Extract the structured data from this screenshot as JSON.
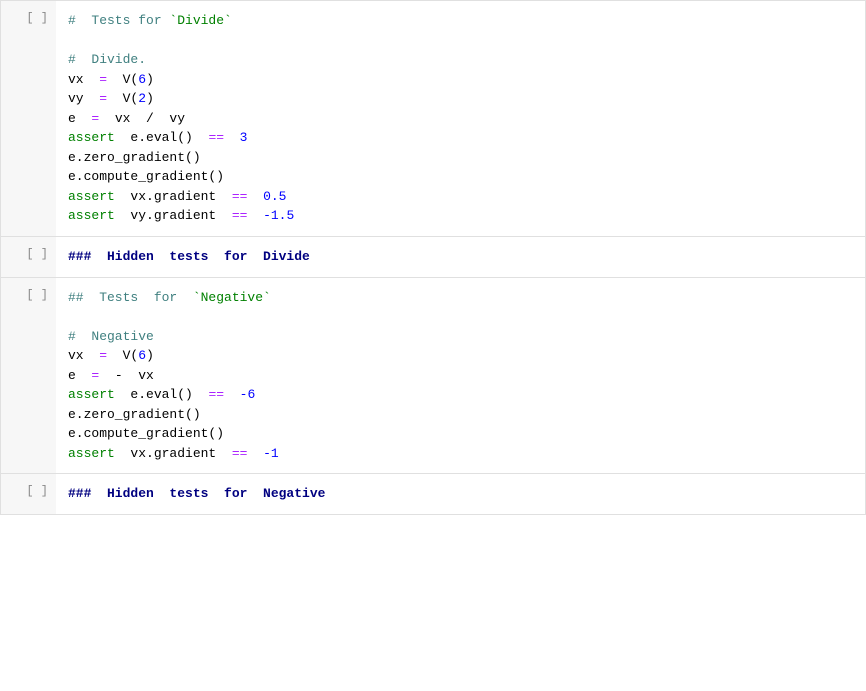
{
  "cells": [
    {
      "id": "cell-1",
      "gutter": "[ ]",
      "lines": [
        {
          "id": "l1",
          "parts": [
            {
              "type": "comment",
              "text": "#  Tests for "
            },
            {
              "type": "backtick",
              "text": "`Divide`"
            }
          ]
        },
        {
          "id": "l2",
          "parts": []
        },
        {
          "id": "l3",
          "parts": [
            {
              "type": "comment",
              "text": "#  Divide."
            }
          ]
        },
        {
          "id": "l4",
          "parts": [
            {
              "type": "plain",
              "text": "vx  "
            },
            {
              "type": "op",
              "text": "="
            },
            {
              "type": "plain",
              "text": "  V("
            },
            {
              "type": "num",
              "text": "6"
            },
            {
              "type": "plain",
              "text": ")"
            }
          ]
        },
        {
          "id": "l5",
          "parts": [
            {
              "type": "plain",
              "text": "vy  "
            },
            {
              "type": "op",
              "text": "="
            },
            {
              "type": "plain",
              "text": "  V("
            },
            {
              "type": "num",
              "text": "2"
            },
            {
              "type": "plain",
              "text": ")"
            }
          ]
        },
        {
          "id": "l6",
          "parts": [
            {
              "type": "plain",
              "text": "e  "
            },
            {
              "type": "op",
              "text": "="
            },
            {
              "type": "plain",
              "text": "  vx  /  vy"
            }
          ]
        },
        {
          "id": "l7",
          "parts": [
            {
              "type": "assert",
              "text": "assert"
            },
            {
              "type": "plain",
              "text": "  e.eval()  "
            },
            {
              "type": "op",
              "text": "=="
            },
            {
              "type": "plain",
              "text": "  "
            },
            {
              "type": "num",
              "text": "3"
            }
          ]
        },
        {
          "id": "l8",
          "parts": [
            {
              "type": "plain",
              "text": "e.zero_gradient()"
            }
          ]
        },
        {
          "id": "l9",
          "parts": [
            {
              "type": "plain",
              "text": "e.compute_gradient()"
            }
          ]
        },
        {
          "id": "l10",
          "parts": [
            {
              "type": "assert",
              "text": "assert"
            },
            {
              "type": "plain",
              "text": "  vx.gradient  "
            },
            {
              "type": "op",
              "text": "=="
            },
            {
              "type": "plain",
              "text": "  "
            },
            {
              "type": "num",
              "text": "0.5"
            }
          ]
        },
        {
          "id": "l11",
          "parts": [
            {
              "type": "assert",
              "text": "assert"
            },
            {
              "type": "plain",
              "text": "  vy.gradient  "
            },
            {
              "type": "op",
              "text": "=="
            },
            {
              "type": "plain",
              "text": "  "
            },
            {
              "type": "neg-num",
              "text": "-1.5"
            }
          ]
        }
      ]
    },
    {
      "id": "cell-2",
      "gutter": "[ ]",
      "lines": [
        {
          "id": "l1",
          "parts": [
            {
              "type": "header",
              "text": "###  Hidden  tests  for  Divide"
            }
          ]
        }
      ]
    },
    {
      "id": "cell-3",
      "gutter": "[ ]",
      "lines": [
        {
          "id": "l1",
          "parts": [
            {
              "type": "comment",
              "text": "##  Tests  for  "
            },
            {
              "type": "backtick",
              "text": "`Negative`"
            }
          ]
        },
        {
          "id": "l2",
          "parts": []
        },
        {
          "id": "l3",
          "parts": [
            {
              "type": "comment",
              "text": "#  Negative"
            }
          ]
        },
        {
          "id": "l4",
          "parts": [
            {
              "type": "plain",
              "text": "vx  "
            },
            {
              "type": "op",
              "text": "="
            },
            {
              "type": "plain",
              "text": "  V("
            },
            {
              "type": "num",
              "text": "6"
            },
            {
              "type": "plain",
              "text": ")"
            }
          ]
        },
        {
          "id": "l5",
          "parts": [
            {
              "type": "plain",
              "text": "e  "
            },
            {
              "type": "op",
              "text": "="
            },
            {
              "type": "plain",
              "text": "  -  vx"
            }
          ]
        },
        {
          "id": "l6",
          "parts": [
            {
              "type": "assert",
              "text": "assert"
            },
            {
              "type": "plain",
              "text": "  e.eval()  "
            },
            {
              "type": "op",
              "text": "=="
            },
            {
              "type": "plain",
              "text": "  "
            },
            {
              "type": "neg-num",
              "text": "-6"
            }
          ]
        },
        {
          "id": "l7",
          "parts": [
            {
              "type": "plain",
              "text": "e.zero_gradient()"
            }
          ]
        },
        {
          "id": "l8",
          "parts": [
            {
              "type": "plain",
              "text": "e.compute_gradient()"
            }
          ]
        },
        {
          "id": "l9",
          "parts": [
            {
              "type": "assert",
              "text": "assert"
            },
            {
              "type": "plain",
              "text": "  vx.gradient  "
            },
            {
              "type": "op",
              "text": "=="
            },
            {
              "type": "plain",
              "text": "  "
            },
            {
              "type": "neg-num",
              "text": "-1"
            }
          ]
        }
      ]
    },
    {
      "id": "cell-4",
      "gutter": "[ ]",
      "lines": [
        {
          "id": "l1",
          "parts": [
            {
              "type": "header",
              "text": "###  Hidden  tests  for  Negative"
            }
          ]
        }
      ]
    }
  ]
}
